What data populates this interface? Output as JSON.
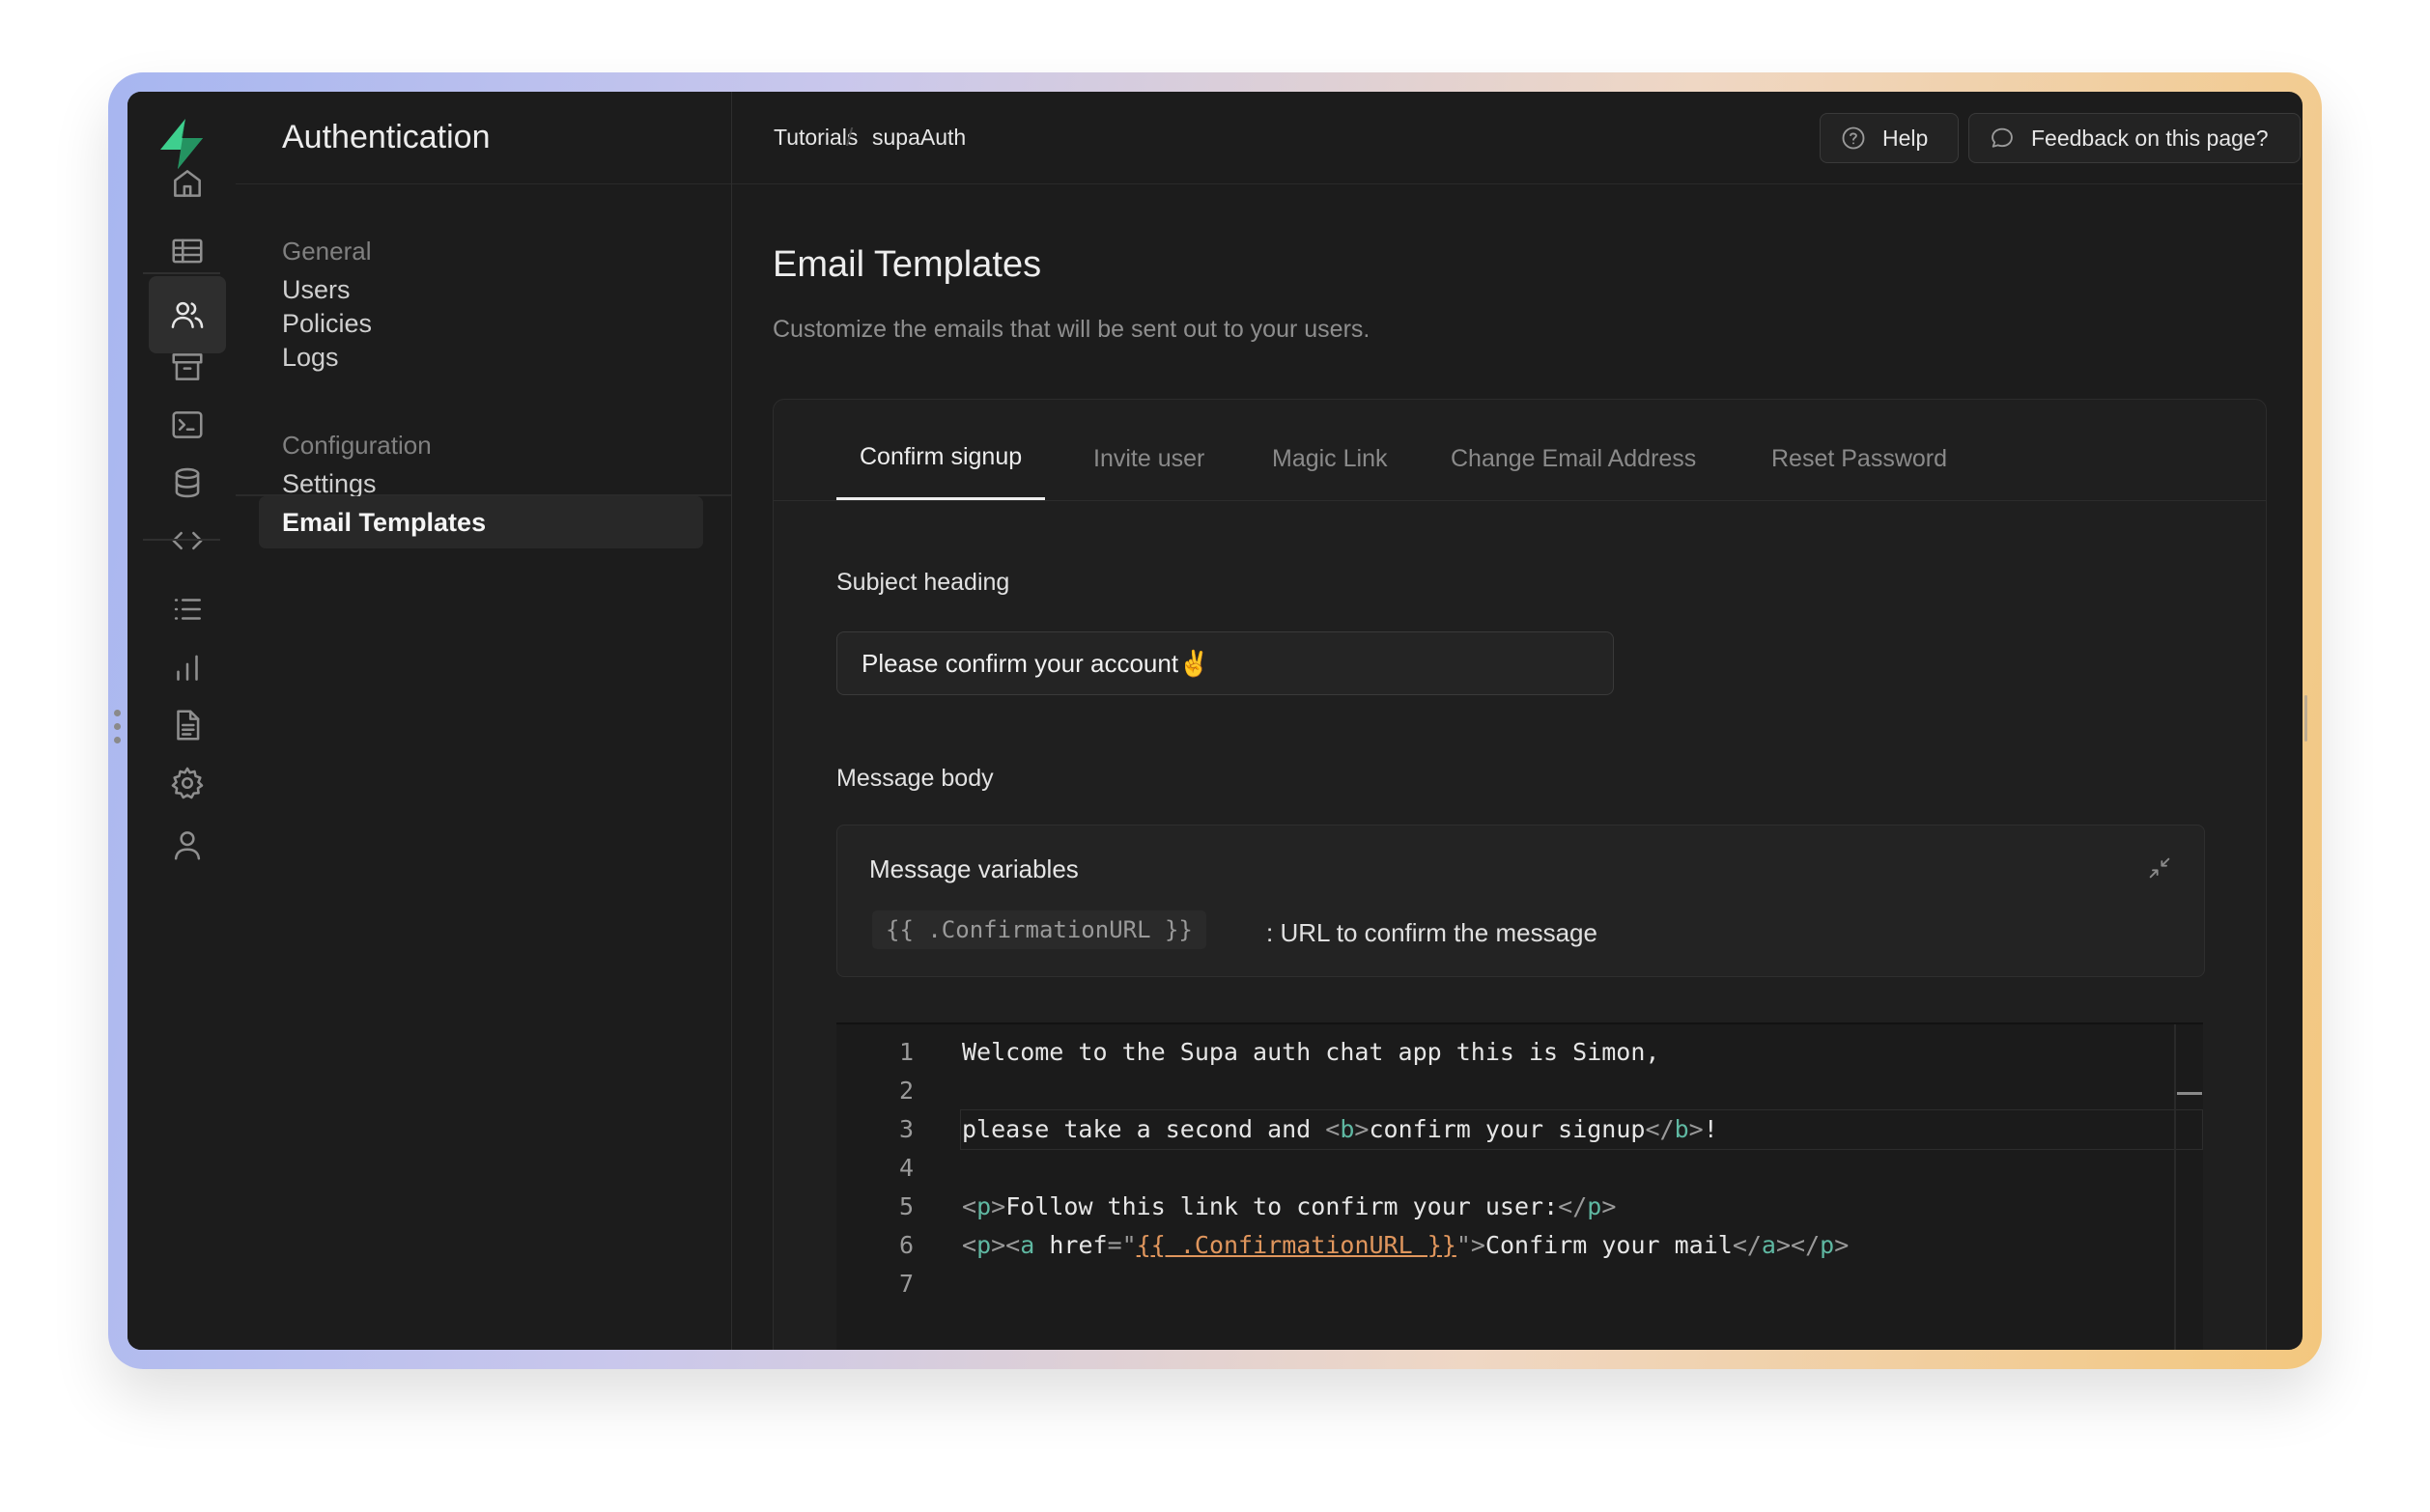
{
  "sidebar": {
    "title": "Authentication",
    "sections": [
      {
        "heading": "General",
        "items": [
          "Users",
          "Policies",
          "Logs"
        ]
      },
      {
        "heading": "Configuration",
        "items": [
          "Settings",
          "Email Templates"
        ]
      }
    ],
    "active_item": "Email Templates"
  },
  "rail": {
    "icons": [
      "home-icon",
      "table-icon",
      "users-icon",
      "archive-icon",
      "terminal-icon",
      "database-icon",
      "code-icon",
      "list-icon",
      "chart-icon",
      "document-icon",
      "settings-icon",
      "user-icon"
    ],
    "active": "users-icon"
  },
  "topbar": {
    "breadcrumb": [
      "Tutorials",
      "supaAuth"
    ],
    "help_label": "Help",
    "feedback_label": "Feedback on this page?",
    "notification_dot_color": "#3ecf8e"
  },
  "page": {
    "title": "Email Templates",
    "subtitle": "Customize the emails that will be sent out to your users."
  },
  "tabs": [
    "Confirm signup",
    "Invite user",
    "Magic Link",
    "Change Email Address",
    "Reset Password"
  ],
  "active_tab": "Confirm signup",
  "form": {
    "subject_label": "Subject heading",
    "subject_value": "Please confirm your account✌️",
    "body_label": "Message body",
    "variables_title": "Message variables",
    "variable_code": "{{ .ConfirmationURL }}",
    "variable_desc": ": URL to confirm the message"
  },
  "editor": {
    "line_numbers": [
      "1",
      "2",
      "3",
      "4",
      "5",
      "6",
      "7"
    ],
    "line1": "Welcome to the Supa auth chat app this is Simon,",
    "line3_a": "please take a second and ",
    "line3_b": "confirm your signup",
    "line3_c": "!",
    "line5_text": "Follow this link to confirm your user:",
    "line6_href_attr": "href",
    "line6_href_value": "{{ .ConfirmationURL }}",
    "line6_link_text": "Confirm your mail"
  },
  "accent_color": "#3ecf8e"
}
